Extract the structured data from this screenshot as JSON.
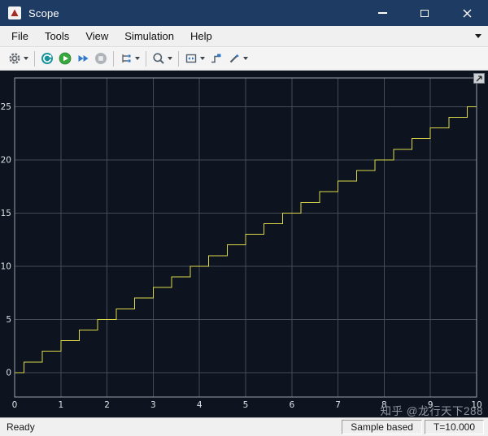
{
  "window": {
    "title": "Scope"
  },
  "colors": {
    "titlebar": "#1e3b63"
  },
  "menubar": {
    "items": [
      {
        "label": "File"
      },
      {
        "label": "Tools"
      },
      {
        "label": "View"
      },
      {
        "label": "Simulation"
      },
      {
        "label": "Help"
      }
    ]
  },
  "toolbar": {
    "icons": [
      "settings-gear-icon",
      "circular-arrow-icon",
      "run-icon",
      "step-forward-icon",
      "stop-icon",
      "signal-selector-icon",
      "zoom-icon",
      "fit-to-view-icon",
      "trigger-icon",
      "measurements-icon"
    ]
  },
  "statusbar": {
    "left": "Ready",
    "panels": [
      "Sample based",
      "T=10.000"
    ]
  },
  "watermark": "知乎 @龙行天下288",
  "chart_data": {
    "type": "line",
    "style": "staircase",
    "xlim": [
      0,
      10
    ],
    "ylim": [
      -2.3,
      27.7
    ],
    "x_ticks": [
      0,
      1,
      2,
      3,
      4,
      5,
      6,
      7,
      8,
      9,
      10
    ],
    "y_ticks": [
      0,
      5,
      10,
      15,
      20,
      25
    ],
    "grid": true,
    "legend": "none",
    "background": "#0d1420",
    "grid_color": "#434c57",
    "axis_color": "#9aa2aa",
    "tick_label_color": "#dde1e5",
    "series": [
      {
        "name": "staircase-signal",
        "color": "#dcd84a",
        "start": [
          0,
          0
        ],
        "end": [
          10,
          25
        ],
        "first_plateau_end": 0.2,
        "step_width": 0.4,
        "step_height": 1
      }
    ]
  }
}
